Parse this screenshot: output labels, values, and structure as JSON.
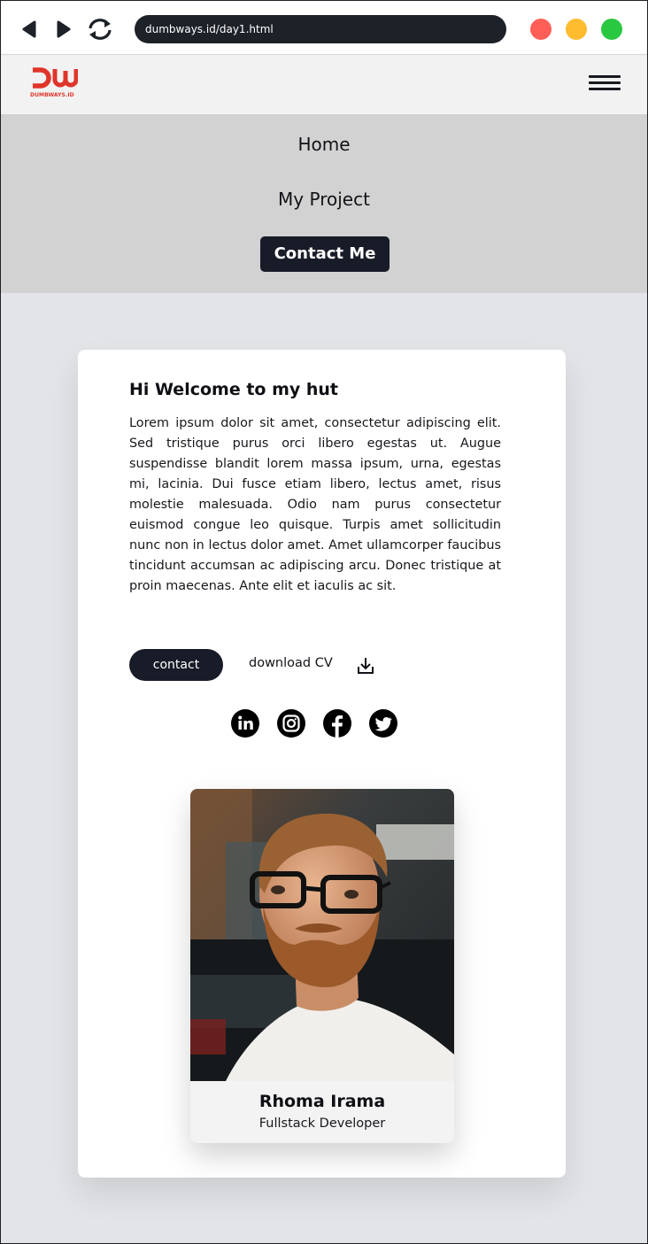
{
  "browser": {
    "url": "dumbways.id/day1.html",
    "icons": [
      "back-icon",
      "forward-icon",
      "refresh-icon"
    ],
    "window_dots": [
      "#ff5f57",
      "#febc2e",
      "#28c840"
    ]
  },
  "header": {
    "logo_text": "DUMBWAYS.ID",
    "brand_color": "#e0352b",
    "menu_icon": "hamburger-icon"
  },
  "menu": {
    "home": "Home",
    "project": "My Project",
    "contact": "Contact Me"
  },
  "intro": {
    "title": "Hi Welcome to my hut",
    "body": "Lorem ipsum dolor sit amet, consectetur adipiscing elit. Sed tristique purus orci libero egestas ut. Augue suspendisse blandit lorem massa ipsum, urna, egestas mi, lacinia. Dui fusce etiam libero, lectus amet, risus molestie malesuada. Odio nam purus consectetur euismod congue leo quisque. Turpis amet sollicitudin nunc non in lectus dolor amet. Amet ullamcorper faucibus tincidunt accumsan ac adipiscing arcu. Donec tristique at proin maecenas. Ante elit et iaculis ac sit.",
    "contact_label": "contact",
    "download_label": "download CV",
    "social_icons": [
      "linkedin-icon",
      "instagram-icon",
      "facebook-icon",
      "twitter-icon"
    ]
  },
  "profile": {
    "name": "Rhoma Irama",
    "role": "Fullstack Developer"
  }
}
